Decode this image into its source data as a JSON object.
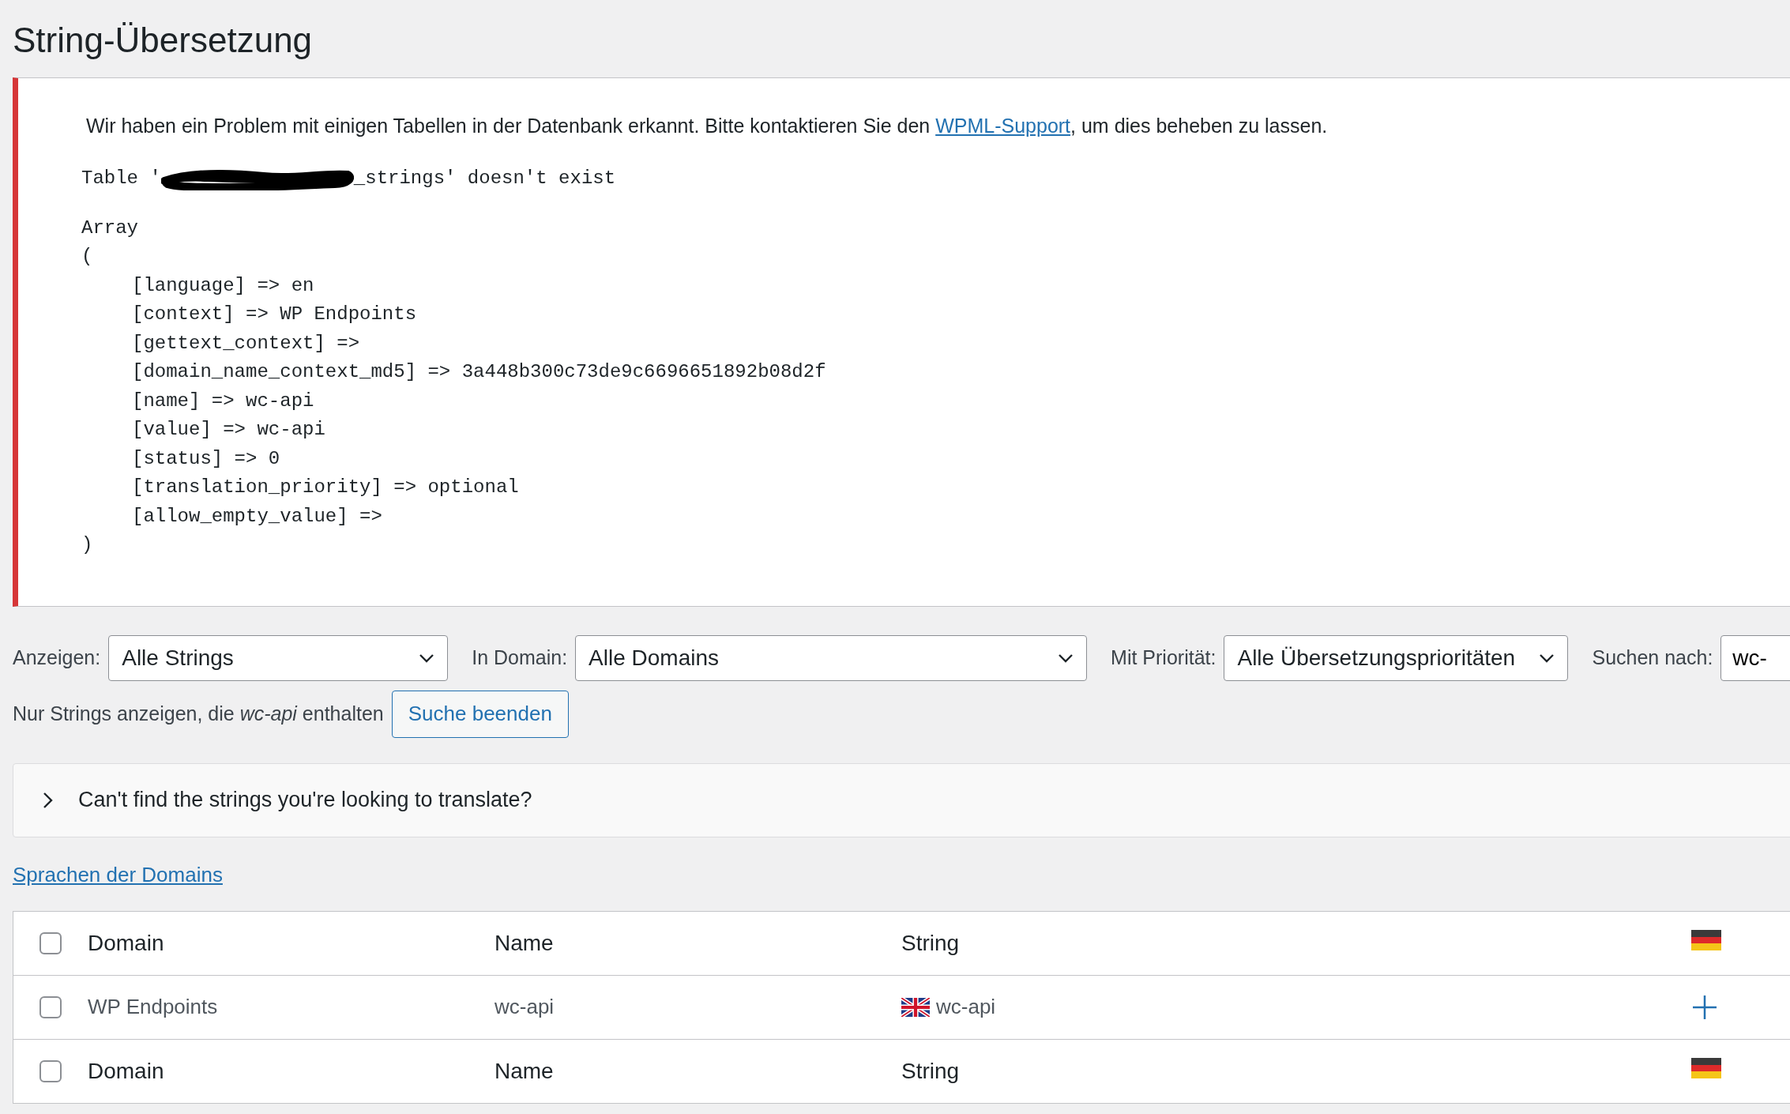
{
  "title": "String-Übersetzung",
  "notice": {
    "message_before": "Wir haben ein Problem mit einigen Tabellen in der Datenbank erkannt. Bitte kontaktieren Sie den ",
    "link": "WPML-Support",
    "message_after": ", um dies beheben zu lassen.",
    "error_before": "Table '",
    "error_after": "_strings' doesn't exist",
    "array_label": "Array",
    "array_open": "(",
    "entries": [
      "[language] => en",
      "[context] => WP Endpoints",
      "[gettext_context] =>",
      "[domain_name_context_md5] => 3a448b300c73de9c6696651892b08d2f",
      "[name] => wc-api",
      "[value] => wc-api",
      "[status] => 0",
      "[translation_priority] => optional",
      "[allow_empty_value] =>"
    ],
    "array_close": ")"
  },
  "filters": [
    {
      "label": "Anzeigen:",
      "value": "Alle Strings",
      "kind": "select"
    },
    {
      "label": "In Domain:",
      "value": "Alle Domains",
      "kind": "select"
    },
    {
      "label": "Mit Priorität:",
      "value": "Alle Übersetzungsprioritäten",
      "kind": "select"
    },
    {
      "label": "Suchen nach:",
      "value": "wc-",
      "kind": "text"
    }
  ],
  "search_info": "Nur Strings anzeigen, die *wc-api* enthalten",
  "stop_search": "Suche beenden",
  "collapsible": {
    "label": "Can't find the strings you're looking to translate?",
    "expanded": false
  },
  "domain_languages_link": "Sprachen der Domains",
  "table": {
    "header": {
      "checked": false,
      "columns": [
        "Domain",
        "Name",
        "String"
      ]
    },
    "rows": [
      {
        "checked": false,
        "domain": "WP Endpoints",
        "name": "wc-api",
        "string": "wc-api"
      }
    ],
    "footer": {
      "checked": false,
      "columns": [
        "Domain",
        "Name",
        "String"
      ]
    }
  }
}
